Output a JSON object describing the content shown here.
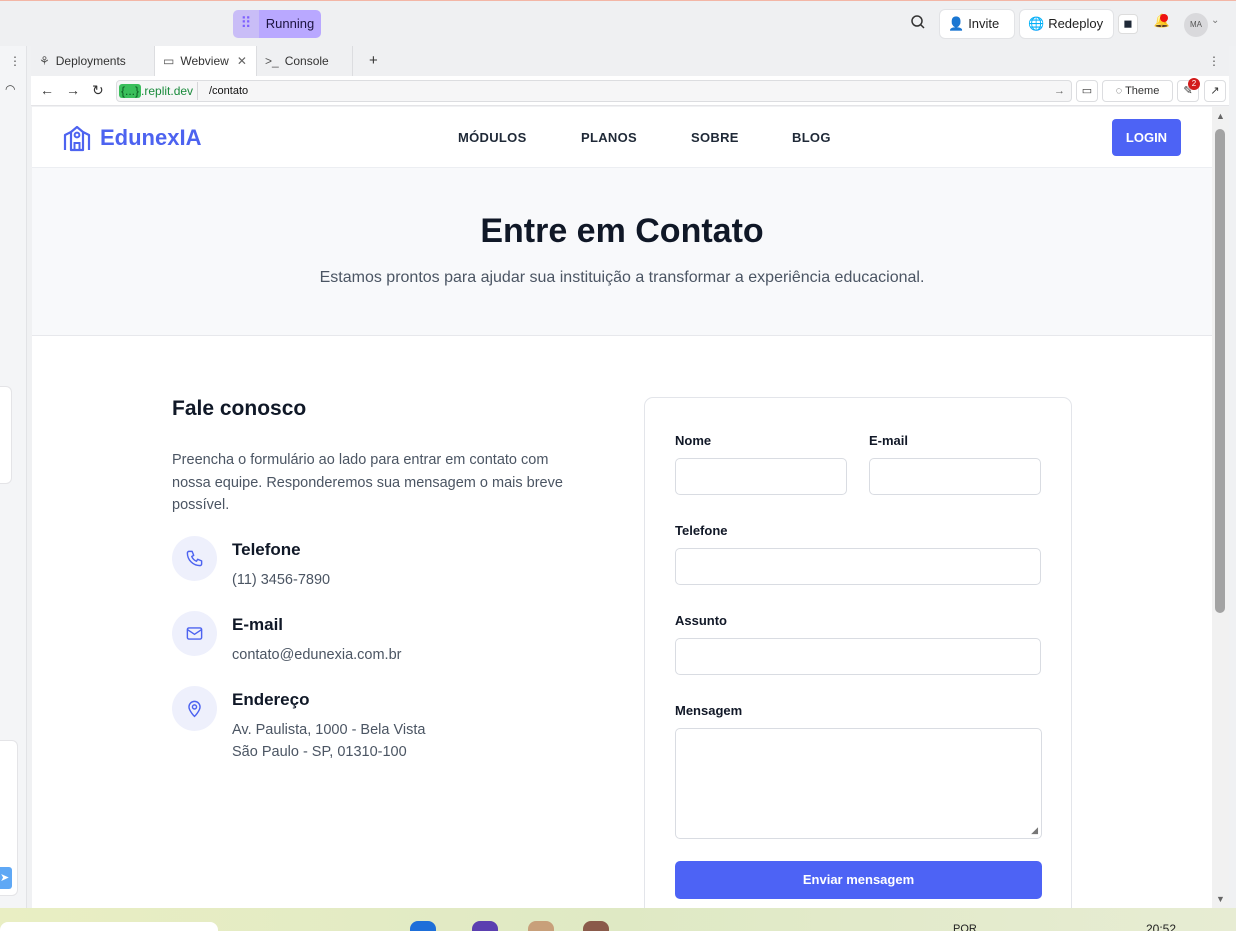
{
  "topbar": {
    "run_label": "Running",
    "invite_label": "Invite",
    "redeploy_label": "Redeploy",
    "avatar_initials": "MA"
  },
  "tabs": {
    "deployments": "Deployments",
    "webview": "Webview",
    "console": "Console"
  },
  "address": {
    "host_chip": "{...}",
    "host_suffix": ".replit.dev",
    "path": "/contato",
    "theme_label": "Theme",
    "badge_count": "2"
  },
  "site": {
    "brand": "EdunexIA",
    "accent_color": "#4d63f5",
    "nav": [
      "MÓDULOS",
      "PLANOS",
      "SOBRE",
      "BLOG"
    ],
    "login_label": "LOGIN"
  },
  "hero": {
    "title": "Entre em Contato",
    "subtitle": "Estamos prontos para ajudar sua instituição a transformar a experiência educacional."
  },
  "contact": {
    "heading": "Fale conosco",
    "intro": "Preencha o formulário ao lado para entrar em contato com nossa equipe. Responderemos sua mensagem o mais breve possível.",
    "items": [
      {
        "icon": "phone-icon",
        "title": "Telefone",
        "lines": [
          "(11) 3456-7890"
        ]
      },
      {
        "icon": "mail-icon",
        "title": "E-mail",
        "lines": [
          "contato@edunexia.com.br"
        ]
      },
      {
        "icon": "map-pin-icon",
        "title": "Endereço",
        "lines": [
          "Av. Paulista, 1000 - Bela Vista",
          "São Paulo - SP, 01310-100"
        ]
      }
    ]
  },
  "form": {
    "name_label": "Nome",
    "email_label": "E-mail",
    "phone_label": "Telefone",
    "subject_label": "Assunto",
    "message_label": "Mensagem",
    "submit_label": "Enviar mensagem"
  },
  "taskbar": {
    "lang": "POR",
    "time": "20:52"
  }
}
